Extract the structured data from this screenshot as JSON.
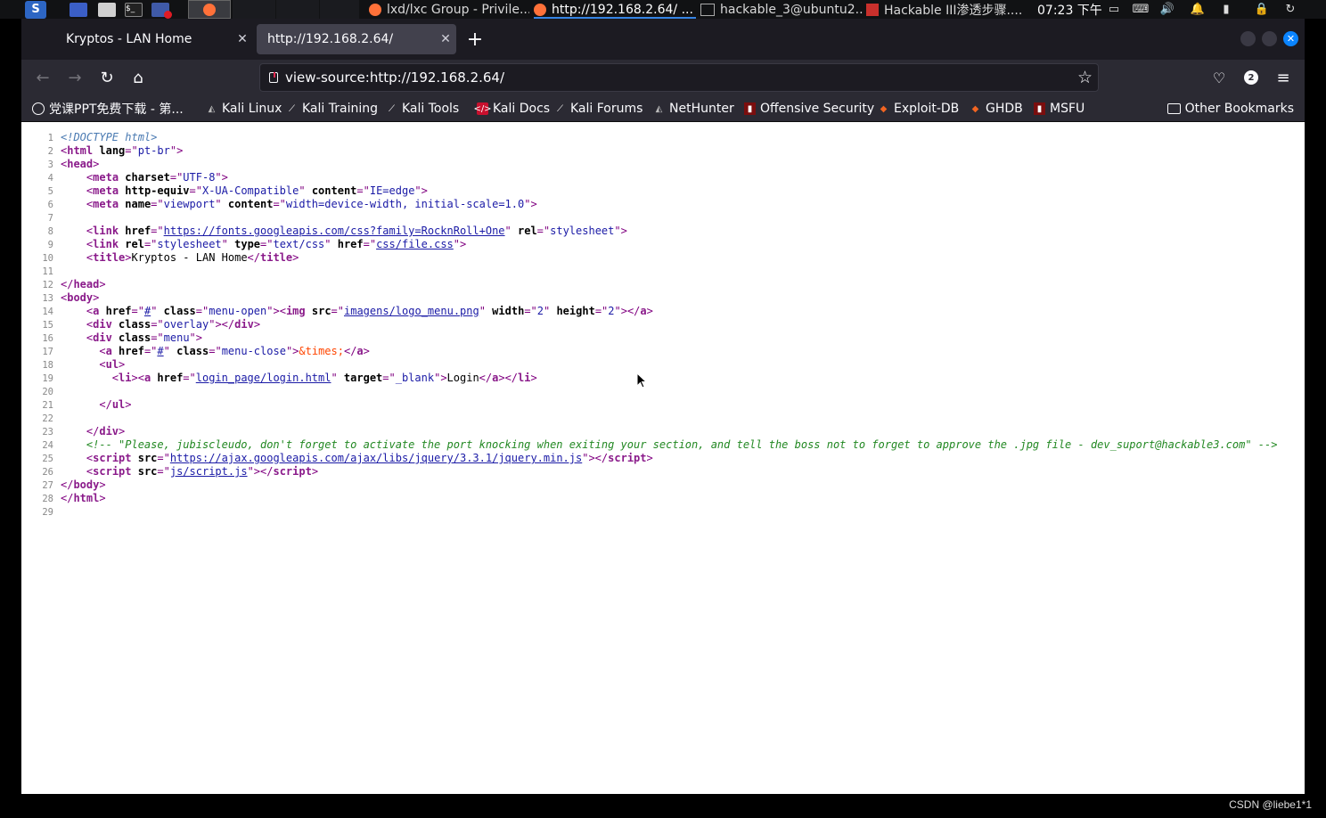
{
  "taskbar": {
    "windows": [
      {
        "label": "lxd/lxc Group - Privile...",
        "icon": "firefox-icon"
      },
      {
        "label": "http://192.168.2.64/ ...",
        "icon": "firefox-icon"
      },
      {
        "label": "hackable_3@ubuntu2...",
        "icon": "terminal-icon"
      },
      {
        "label": "Hackable III渗透步骤....",
        "icon": "wps-icon"
      }
    ],
    "clock": "07:23 下午"
  },
  "tabs": [
    {
      "label": "Kryptos - LAN Home",
      "selected": false
    },
    {
      "label": "http://192.168.2.64/",
      "selected": true
    }
  ],
  "navbar": {
    "url": "view-source:http://192.168.2.64/",
    "extension_badge": "2"
  },
  "bookmarks": [
    {
      "label": "党课PPT免费下载 - 第...",
      "icon": "globe-icon"
    },
    {
      "label": "Kali Linux",
      "icon": "kali-icon"
    },
    {
      "label": "Kali Training",
      "icon": "kali-dragon-icon"
    },
    {
      "label": "Kali Tools",
      "icon": "kali-dragon-icon"
    },
    {
      "label": "Kali Docs",
      "icon": "kali-docs-icon"
    },
    {
      "label": "Kali Forums",
      "icon": "kali-dragon-icon"
    },
    {
      "label": "NetHunter",
      "icon": "kali-icon"
    },
    {
      "label": "Offensive Security",
      "icon": "offsec-icon"
    },
    {
      "label": "Exploit-DB",
      "icon": "exploitdb-icon"
    },
    {
      "label": "GHDB",
      "icon": "exploitdb-icon"
    },
    {
      "label": "MSFU",
      "icon": "offsec-icon"
    }
  ],
  "other_bookmarks": "Other Bookmarks",
  "source_lines": [
    [
      [
        "dt",
        "<!DOCTYPE html>"
      ]
    ],
    [
      [
        "tag",
        "<"
      ],
      [
        "tn",
        "html"
      ],
      [
        "an",
        " lang"
      ],
      [
        "tag",
        "=\""
      ],
      [
        "av",
        "pt-br"
      ],
      [
        "tag",
        "\">"
      ]
    ],
    [
      [
        "tag",
        "<"
      ],
      [
        "tn",
        "head"
      ],
      [
        "tag",
        ">"
      ]
    ],
    [
      [
        "p",
        "    "
      ],
      [
        "tag",
        "<"
      ],
      [
        "tn",
        "meta"
      ],
      [
        "an",
        " charset"
      ],
      [
        "tag",
        "=\""
      ],
      [
        "av",
        "UTF-8"
      ],
      [
        "tag",
        "\">"
      ]
    ],
    [
      [
        "p",
        "    "
      ],
      [
        "tag",
        "<"
      ],
      [
        "tn",
        "meta"
      ],
      [
        "an",
        " http-equiv"
      ],
      [
        "tag",
        "=\""
      ],
      [
        "av",
        "X-UA-Compatible"
      ],
      [
        "tag",
        "\""
      ],
      [
        "an",
        " content"
      ],
      [
        "tag",
        "=\""
      ],
      [
        "av",
        "IE=edge"
      ],
      [
        "tag",
        "\">"
      ]
    ],
    [
      [
        "p",
        "    "
      ],
      [
        "tag",
        "<"
      ],
      [
        "tn",
        "meta"
      ],
      [
        "an",
        " name"
      ],
      [
        "tag",
        "=\""
      ],
      [
        "av",
        "viewport"
      ],
      [
        "tag",
        "\""
      ],
      [
        "an",
        " content"
      ],
      [
        "tag",
        "=\""
      ],
      [
        "av",
        "width=device-width, initial-scale=1.0"
      ],
      [
        "tag",
        "\">"
      ]
    ],
    [],
    [
      [
        "p",
        "    "
      ],
      [
        "tag",
        "<"
      ],
      [
        "tn",
        "link"
      ],
      [
        "an",
        " href"
      ],
      [
        "tag",
        "=\""
      ],
      [
        "lnk",
        "https://fonts.googleapis.com/css?family=RocknRoll+One"
      ],
      [
        "tag",
        "\""
      ],
      [
        "an",
        " rel"
      ],
      [
        "tag",
        "=\""
      ],
      [
        "av",
        "stylesheet"
      ],
      [
        "tag",
        "\">"
      ]
    ],
    [
      [
        "p",
        "    "
      ],
      [
        "tag",
        "<"
      ],
      [
        "tn",
        "link"
      ],
      [
        "an",
        " rel"
      ],
      [
        "tag",
        "=\""
      ],
      [
        "av",
        "stylesheet"
      ],
      [
        "tag",
        "\""
      ],
      [
        "an",
        " type"
      ],
      [
        "tag",
        "=\""
      ],
      [
        "av",
        "text/css"
      ],
      [
        "tag",
        "\""
      ],
      [
        "an",
        " href"
      ],
      [
        "tag",
        "=\""
      ],
      [
        "lnk",
        "css/file.css"
      ],
      [
        "tag",
        "\">"
      ]
    ],
    [
      [
        "p",
        "    "
      ],
      [
        "tag",
        "<"
      ],
      [
        "tn",
        "title"
      ],
      [
        "tag",
        ">"
      ],
      [
        "p",
        "Kryptos - LAN Home"
      ],
      [
        "tag",
        "</"
      ],
      [
        "tn",
        "title"
      ],
      [
        "tag",
        ">"
      ]
    ],
    [],
    [
      [
        "tag",
        "</"
      ],
      [
        "tn",
        "head"
      ],
      [
        "tag",
        ">"
      ]
    ],
    [
      [
        "tag",
        "<"
      ],
      [
        "tn",
        "body"
      ],
      [
        "tag",
        ">"
      ]
    ],
    [
      [
        "p",
        "    "
      ],
      [
        "tag",
        "<"
      ],
      [
        "tn",
        "a"
      ],
      [
        "an",
        " href"
      ],
      [
        "tag",
        "=\""
      ],
      [
        "lnk",
        "#"
      ],
      [
        "tag",
        "\""
      ],
      [
        "an",
        " class"
      ],
      [
        "tag",
        "=\""
      ],
      [
        "av",
        "menu-open"
      ],
      [
        "tag",
        "\"><"
      ],
      [
        "tn",
        "img"
      ],
      [
        "an",
        " src"
      ],
      [
        "tag",
        "=\""
      ],
      [
        "lnk",
        "imagens/logo_menu.png"
      ],
      [
        "tag",
        "\""
      ],
      [
        "an",
        " width"
      ],
      [
        "tag",
        "=\""
      ],
      [
        "av",
        "2"
      ],
      [
        "tag",
        "\""
      ],
      [
        "an",
        " height"
      ],
      [
        "tag",
        "=\""
      ],
      [
        "av",
        "2"
      ],
      [
        "tag",
        "\"></"
      ],
      [
        "tn",
        "a"
      ],
      [
        "tag",
        ">"
      ]
    ],
    [
      [
        "p",
        "    "
      ],
      [
        "tag",
        "<"
      ],
      [
        "tn",
        "div"
      ],
      [
        "an",
        " class"
      ],
      [
        "tag",
        "=\""
      ],
      [
        "av",
        "overlay"
      ],
      [
        "tag",
        "\"></"
      ],
      [
        "tn",
        "div"
      ],
      [
        "tag",
        ">"
      ]
    ],
    [
      [
        "p",
        "    "
      ],
      [
        "tag",
        "<"
      ],
      [
        "tn",
        "div"
      ],
      [
        "an",
        " class"
      ],
      [
        "tag",
        "=\""
      ],
      [
        "av",
        "menu"
      ],
      [
        "tag",
        "\">"
      ]
    ],
    [
      [
        "p",
        "      "
      ],
      [
        "tag",
        "<"
      ],
      [
        "tn",
        "a"
      ],
      [
        "an",
        " href"
      ],
      [
        "tag",
        "=\""
      ],
      [
        "lnk",
        "#"
      ],
      [
        "tag",
        "\""
      ],
      [
        "an",
        " class"
      ],
      [
        "tag",
        "=\""
      ],
      [
        "av",
        "menu-close"
      ],
      [
        "tag",
        "\">"
      ],
      [
        "ent",
        "&times;"
      ],
      [
        "tag",
        "</"
      ],
      [
        "tn",
        "a"
      ],
      [
        "tag",
        ">"
      ]
    ],
    [
      [
        "p",
        "      "
      ],
      [
        "tag",
        "<"
      ],
      [
        "tn",
        "ul"
      ],
      [
        "tag",
        ">"
      ]
    ],
    [
      [
        "p",
        "        "
      ],
      [
        "tag",
        "<"
      ],
      [
        "tn",
        "li"
      ],
      [
        "tag",
        "><"
      ],
      [
        "tn",
        "a"
      ],
      [
        "an",
        " href"
      ],
      [
        "tag",
        "=\""
      ],
      [
        "lnk",
        "login_page/login.html"
      ],
      [
        "tag",
        "\""
      ],
      [
        "an",
        " target"
      ],
      [
        "tag",
        "=\""
      ],
      [
        "av",
        "_blank"
      ],
      [
        "tag",
        "\">"
      ],
      [
        "p",
        "Login"
      ],
      [
        "tag",
        "</"
      ],
      [
        "tn",
        "a"
      ],
      [
        "tag",
        "></"
      ],
      [
        "tn",
        "li"
      ],
      [
        "tag",
        ">"
      ]
    ],
    [],
    [
      [
        "p",
        "      "
      ],
      [
        "tag",
        "</"
      ],
      [
        "tn",
        "ul"
      ],
      [
        "tag",
        ">"
      ]
    ],
    [],
    [
      [
        "p",
        "    "
      ],
      [
        "tag",
        "</"
      ],
      [
        "tn",
        "div"
      ],
      [
        "tag",
        ">"
      ]
    ],
    [
      [
        "p",
        "    "
      ],
      [
        "com",
        "<!-- \"Please, jubiscleudo, don't forget to activate the port knocking when exiting your section, and tell the boss not to forget to approve the .jpg file - dev_suport@hackable3.com\" -->"
      ]
    ],
    [
      [
        "p",
        "    "
      ],
      [
        "tag",
        "<"
      ],
      [
        "tn",
        "script"
      ],
      [
        "an",
        " src"
      ],
      [
        "tag",
        "=\""
      ],
      [
        "lnk",
        "https://ajax.googleapis.com/ajax/libs/jquery/3.3.1/jquery.min.js"
      ],
      [
        "tag",
        "\"></"
      ],
      [
        "tn",
        "script"
      ],
      [
        "tag",
        ">"
      ]
    ],
    [
      [
        "p",
        "    "
      ],
      [
        "tag",
        "<"
      ],
      [
        "tn",
        "script"
      ],
      [
        "an",
        " src"
      ],
      [
        "tag",
        "=\""
      ],
      [
        "lnk",
        "js/script.js"
      ],
      [
        "tag",
        "\"></"
      ],
      [
        "tn",
        "script"
      ],
      [
        "tag",
        ">"
      ]
    ],
    [
      [
        "tag",
        "</"
      ],
      [
        "tn",
        "body"
      ],
      [
        "tag",
        ">"
      ]
    ],
    [
      [
        "tag",
        "</"
      ],
      [
        "tn",
        "html"
      ],
      [
        "tag",
        ">"
      ]
    ],
    []
  ],
  "watermark": "CSDN @liebe1*1",
  "colors": {
    "tab_bar": "#1c1b22",
    "toolbar": "#2b2a33",
    "selected_tab": "#42414d",
    "close_window": "#0a84ff"
  }
}
